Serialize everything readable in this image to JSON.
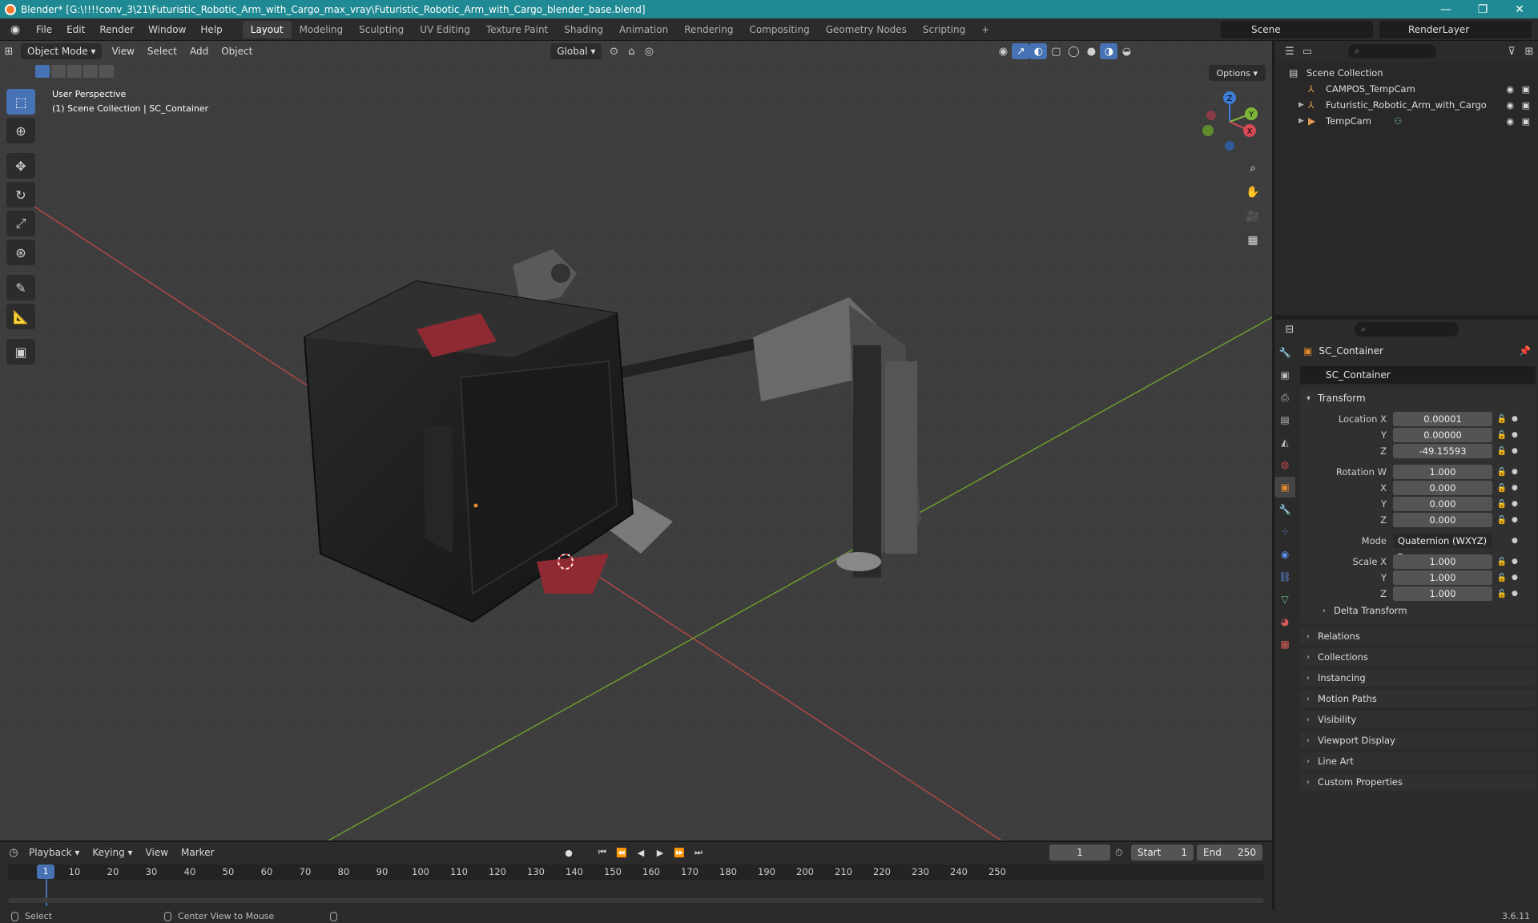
{
  "window": {
    "title": "Blender* [G:\\!!!!conv_3\\21\\Futuristic_Robotic_Arm_with_Cargo_max_vray\\Futuristic_Robotic_Arm_with_Cargo_blender_base.blend]",
    "minimize": "—",
    "maximize": "❐",
    "close": "✕"
  },
  "menu": {
    "items": [
      "File",
      "Edit",
      "Render",
      "Window",
      "Help"
    ],
    "workspaces": [
      "Layout",
      "Modeling",
      "Sculpting",
      "UV Editing",
      "Texture Paint",
      "Shading",
      "Animation",
      "Rendering",
      "Compositing",
      "Geometry Nodes",
      "Scripting"
    ],
    "add_tab": "+",
    "scene": "Scene",
    "render_layer": "RenderLayer"
  },
  "viewport": {
    "mode": "Object Mode",
    "menus": [
      "View",
      "Select",
      "Add",
      "Object"
    ],
    "orientation": "Global",
    "options": "Options",
    "perspective": "User Perspective",
    "collection_info": "(1) Scene Collection | SC_Container",
    "gizmo": {
      "x": "X",
      "y": "Y",
      "z": "Z"
    }
  },
  "outliner": {
    "root": "Scene Collection",
    "items": [
      {
        "name": "CAMPOS_TempCam",
        "icon": "empty-icon",
        "expandable": false
      },
      {
        "name": "Futuristic_Robotic_Arm_with_Cargo",
        "icon": "empty-icon",
        "expandable": true
      },
      {
        "name": "TempCam",
        "icon": "camera-icon",
        "expandable": true
      }
    ]
  },
  "properties": {
    "object": "SC_Container",
    "object_name_field": "SC_Container",
    "transform_label": "Transform",
    "location": {
      "label": "Location X",
      "x": "0.00001",
      "y": "0.00000",
      "z": "-49.15593"
    },
    "rotation": {
      "label": "Rotation W",
      "w": "1.000",
      "x": "0.000",
      "y": "0.000",
      "z": "0.000"
    },
    "mode": {
      "label": "Mode",
      "value": "Quaternion (WXYZ)"
    },
    "scale": {
      "label": "Scale X",
      "x": "1.000",
      "y": "1.000",
      "z": "1.000"
    },
    "axis_labels": {
      "y": "Y",
      "z": "Z",
      "x": "X"
    },
    "delta": "Delta Transform",
    "panels": [
      "Relations",
      "Collections",
      "Instancing",
      "Motion Paths",
      "Visibility",
      "Viewport Display",
      "Line Art",
      "Custom Properties"
    ]
  },
  "timeline": {
    "menus": [
      "Playback",
      "Keying",
      "View",
      "Marker"
    ],
    "current_frame": "1",
    "start_label": "Start",
    "start": "1",
    "end_label": "End",
    "end": "250",
    "ticks": [
      "10",
      "20",
      "30",
      "40",
      "50",
      "60",
      "70",
      "80",
      "90",
      "100",
      "110",
      "120",
      "130",
      "140",
      "150",
      "160",
      "170",
      "180",
      "190",
      "200",
      "210",
      "220",
      "230",
      "240",
      "250"
    ]
  },
  "status": {
    "select": "Select",
    "center": "Center View to Mouse",
    "version": "3.6.11"
  }
}
